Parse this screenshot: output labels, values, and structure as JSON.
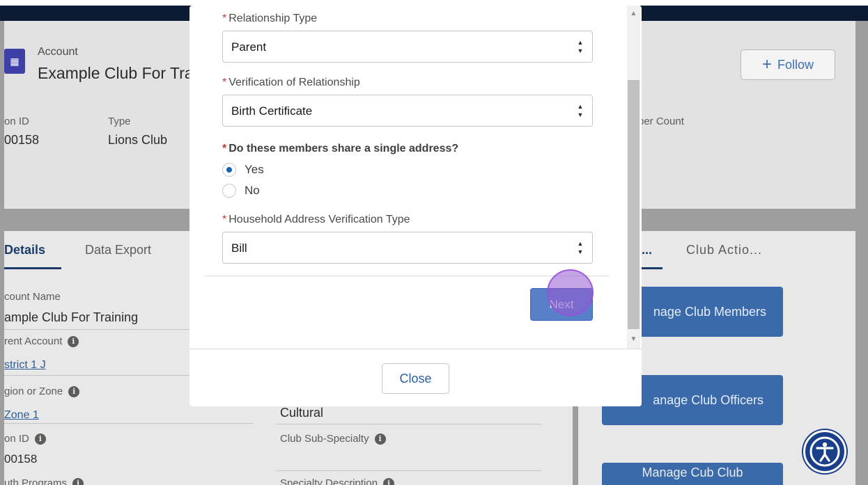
{
  "background": {
    "record": {
      "object_label": "Account",
      "title": "Example Club For Training",
      "follow_label": "Follow",
      "highlights": [
        {
          "label": "on ID",
          "value": "00158"
        },
        {
          "label": "Type",
          "value": "Lions Club"
        },
        {
          "label": "ber Count",
          "value": ""
        }
      ]
    },
    "tabs": {
      "details": "Details",
      "data_export": "Data Export",
      "ellipsis": "...",
      "club_actions": "Club Actio..."
    },
    "fields": {
      "account_name_label": "count Name",
      "account_name_value": "ample Club For Training",
      "parent_account_label": "rent Account",
      "parent_account_value": "strict 1 J",
      "region_label": "gion or Zone",
      "region_value": "Zone 1",
      "id_label": "on ID",
      "id_value": "00158",
      "youth_label": "uth Programs",
      "specialty_value": "Cultural",
      "sub_specialty_label": "Club Sub-Specialty",
      "specialty_desc_label": "Specialty Description"
    },
    "actions": [
      {
        "label": "nage Club Members"
      },
      {
        "label": "anage Club Officers"
      },
      {
        "label": "Manage Cub Club"
      }
    ]
  },
  "modal": {
    "fields": {
      "relationship_type": {
        "label": "Relationship Type",
        "value": "Parent"
      },
      "verification": {
        "label": "Verification of Relationship",
        "value": "Birth Certificate"
      },
      "shared_address": {
        "label": "Do these members share a single address?",
        "options": [
          "Yes",
          "No"
        ],
        "selected": "Yes"
      },
      "household_verification": {
        "label": "Household Address Verification Type",
        "value": "Bill"
      }
    },
    "required_marker": "*",
    "next_label": "Next",
    "close_label": "Close"
  },
  "colors": {
    "accent": "#1b5fb4",
    "required": "#c23934",
    "link": "#2c5d9c",
    "click_indicator": "#9650d2"
  }
}
